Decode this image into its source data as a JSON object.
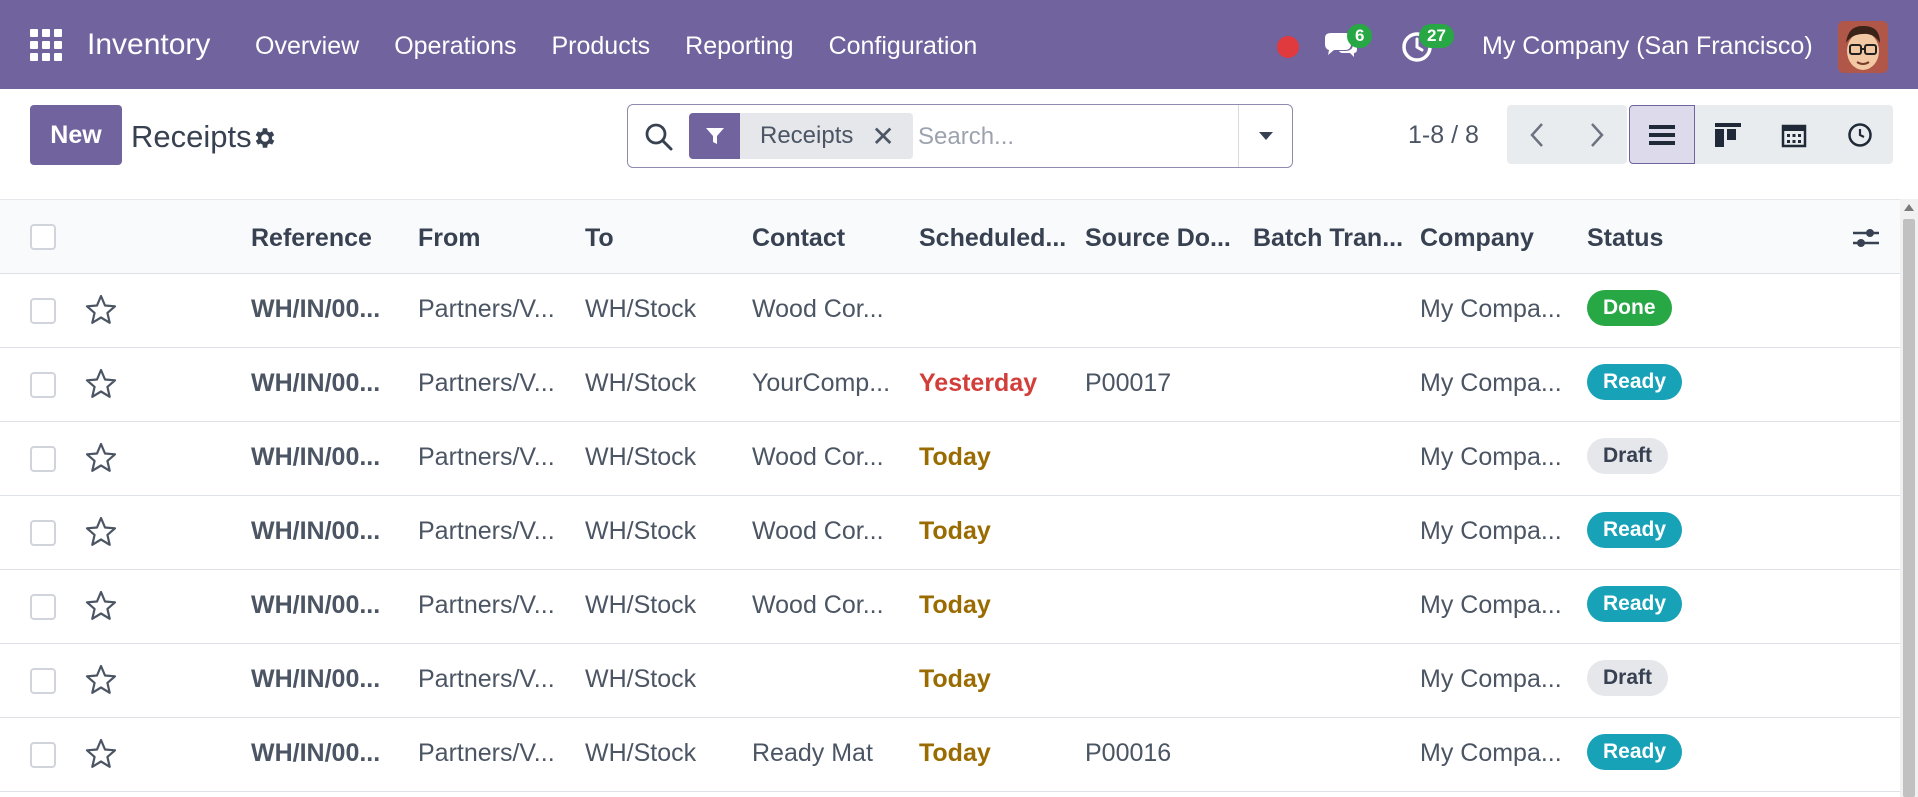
{
  "navbar": {
    "app_name": "Inventory",
    "menu": [
      "Overview",
      "Operations",
      "Products",
      "Reporting",
      "Configuration"
    ],
    "messages_count": "6",
    "activities_count": "27",
    "company": "My Company (San Francisco)",
    "colors": {
      "bar": "#71639e",
      "badge": "#28a745",
      "recording": "#e0393e"
    }
  },
  "control": {
    "new_label": "New",
    "title": "Receipts",
    "search": {
      "facet": "Receipts",
      "facet_remove": "✕",
      "placeholder": "Search..."
    },
    "pager": "1-8 / 8"
  },
  "table": {
    "columns": [
      "Reference",
      "From",
      "To",
      "Contact",
      "Scheduled...",
      "Source Do...",
      "Batch Tran...",
      "Company",
      "Status"
    ],
    "rows": [
      {
        "reference": "WH/IN/00...",
        "from": "Partners/V...",
        "to": "WH/Stock",
        "contact": "Wood Cor...",
        "scheduled": "",
        "source": "",
        "batch": "",
        "company": "My Compa...",
        "status": "Done"
      },
      {
        "reference": "WH/IN/00...",
        "from": "Partners/V...",
        "to": "WH/Stock",
        "contact": "YourComp...",
        "scheduled": "Yesterday",
        "source": "P00017",
        "batch": "",
        "company": "My Compa...",
        "status": "Ready"
      },
      {
        "reference": "WH/IN/00...",
        "from": "Partners/V...",
        "to": "WH/Stock",
        "contact": "Wood Cor...",
        "scheduled": "Today",
        "source": "",
        "batch": "",
        "company": "My Compa...",
        "status": "Draft"
      },
      {
        "reference": "WH/IN/00...",
        "from": "Partners/V...",
        "to": "WH/Stock",
        "contact": "Wood Cor...",
        "scheduled": "Today",
        "source": "",
        "batch": "",
        "company": "My Compa...",
        "status": "Ready"
      },
      {
        "reference": "WH/IN/00...",
        "from": "Partners/V...",
        "to": "WH/Stock",
        "contact": "Wood Cor...",
        "scheduled": "Today",
        "source": "",
        "batch": "",
        "company": "My Compa...",
        "status": "Ready"
      },
      {
        "reference": "WH/IN/00...",
        "from": "Partners/V...",
        "to": "WH/Stock",
        "contact": "",
        "scheduled": "Today",
        "source": "",
        "batch": "",
        "company": "My Compa...",
        "status": "Draft"
      },
      {
        "reference": "WH/IN/00...",
        "from": "Partners/V...",
        "to": "WH/Stock",
        "contact": "Ready Mat",
        "scheduled": "Today",
        "source": "P00016",
        "batch": "",
        "company": "My Compa...",
        "status": "Ready"
      }
    ],
    "status_colors": {
      "Done": "#28a745",
      "Ready": "#17a2b8",
      "Draft": "#e5e7eb"
    },
    "scheduled_colors": {
      "Yesterday": "#d23f3a",
      "Today": "#9a6b00"
    }
  }
}
